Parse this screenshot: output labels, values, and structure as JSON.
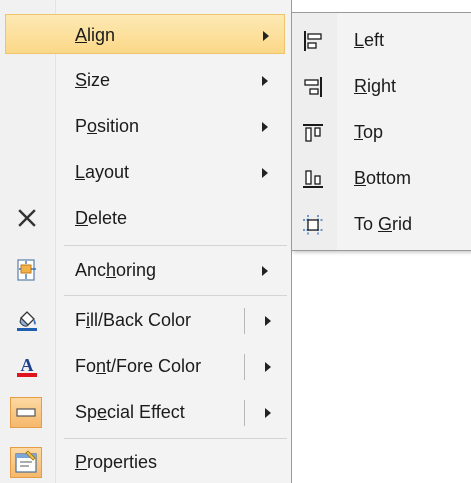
{
  "menu": {
    "items": [
      {
        "label_pre": "",
        "label_u": "A",
        "label_post": "lign",
        "has_arrow": true,
        "highlighted": true
      },
      {
        "label_pre": "",
        "label_u": "S",
        "label_post": "ize",
        "has_arrow": true
      },
      {
        "label_pre": "P",
        "label_u": "o",
        "label_post": "sition",
        "has_arrow": true
      },
      {
        "label_pre": "",
        "label_u": "L",
        "label_post": "ayout",
        "has_arrow": true
      },
      {
        "label_pre": "",
        "label_u": "D",
        "label_post": "elete",
        "icon": "delete-x-icon"
      },
      {
        "label_pre": "Anc",
        "label_u": "h",
        "label_post": "oring",
        "has_arrow": true,
        "icon": "anchoring-icon"
      },
      {
        "label_pre": "F",
        "label_u": "i",
        "label_post": "ll/Back Color",
        "has_arrow": true,
        "icon": "fill-bucket-icon"
      },
      {
        "label_pre": "Fo",
        "label_u": "n",
        "label_post": "t/Fore Color",
        "has_arrow": true,
        "icon": "font-color-icon"
      },
      {
        "label_pre": "Sp",
        "label_u": "e",
        "label_post": "cial Effect",
        "has_arrow": true,
        "icon": "special-effect-icon"
      },
      {
        "label_pre": "",
        "label_u": "P",
        "label_post": "roperties",
        "icon": "properties-icon"
      }
    ]
  },
  "submenu": {
    "items": [
      {
        "label_pre": "",
        "label_u": "L",
        "label_post": "eft",
        "icon": "align-left-icon"
      },
      {
        "label_pre": "",
        "label_u": "R",
        "label_post": "ight",
        "icon": "align-right-icon"
      },
      {
        "label_pre": "",
        "label_u": "T",
        "label_post": "op",
        "icon": "align-top-icon"
      },
      {
        "label_pre": "",
        "label_u": "B",
        "label_post": "ottom",
        "icon": "align-bottom-icon"
      },
      {
        "label_pre": "To ",
        "label_u": "G",
        "label_post": "rid",
        "icon": "align-to-grid-icon"
      }
    ]
  },
  "colors": {
    "highlight": "#fbd888",
    "font_color_bar": "#e0141e",
    "icon_blue": "#1f5fb0"
  }
}
